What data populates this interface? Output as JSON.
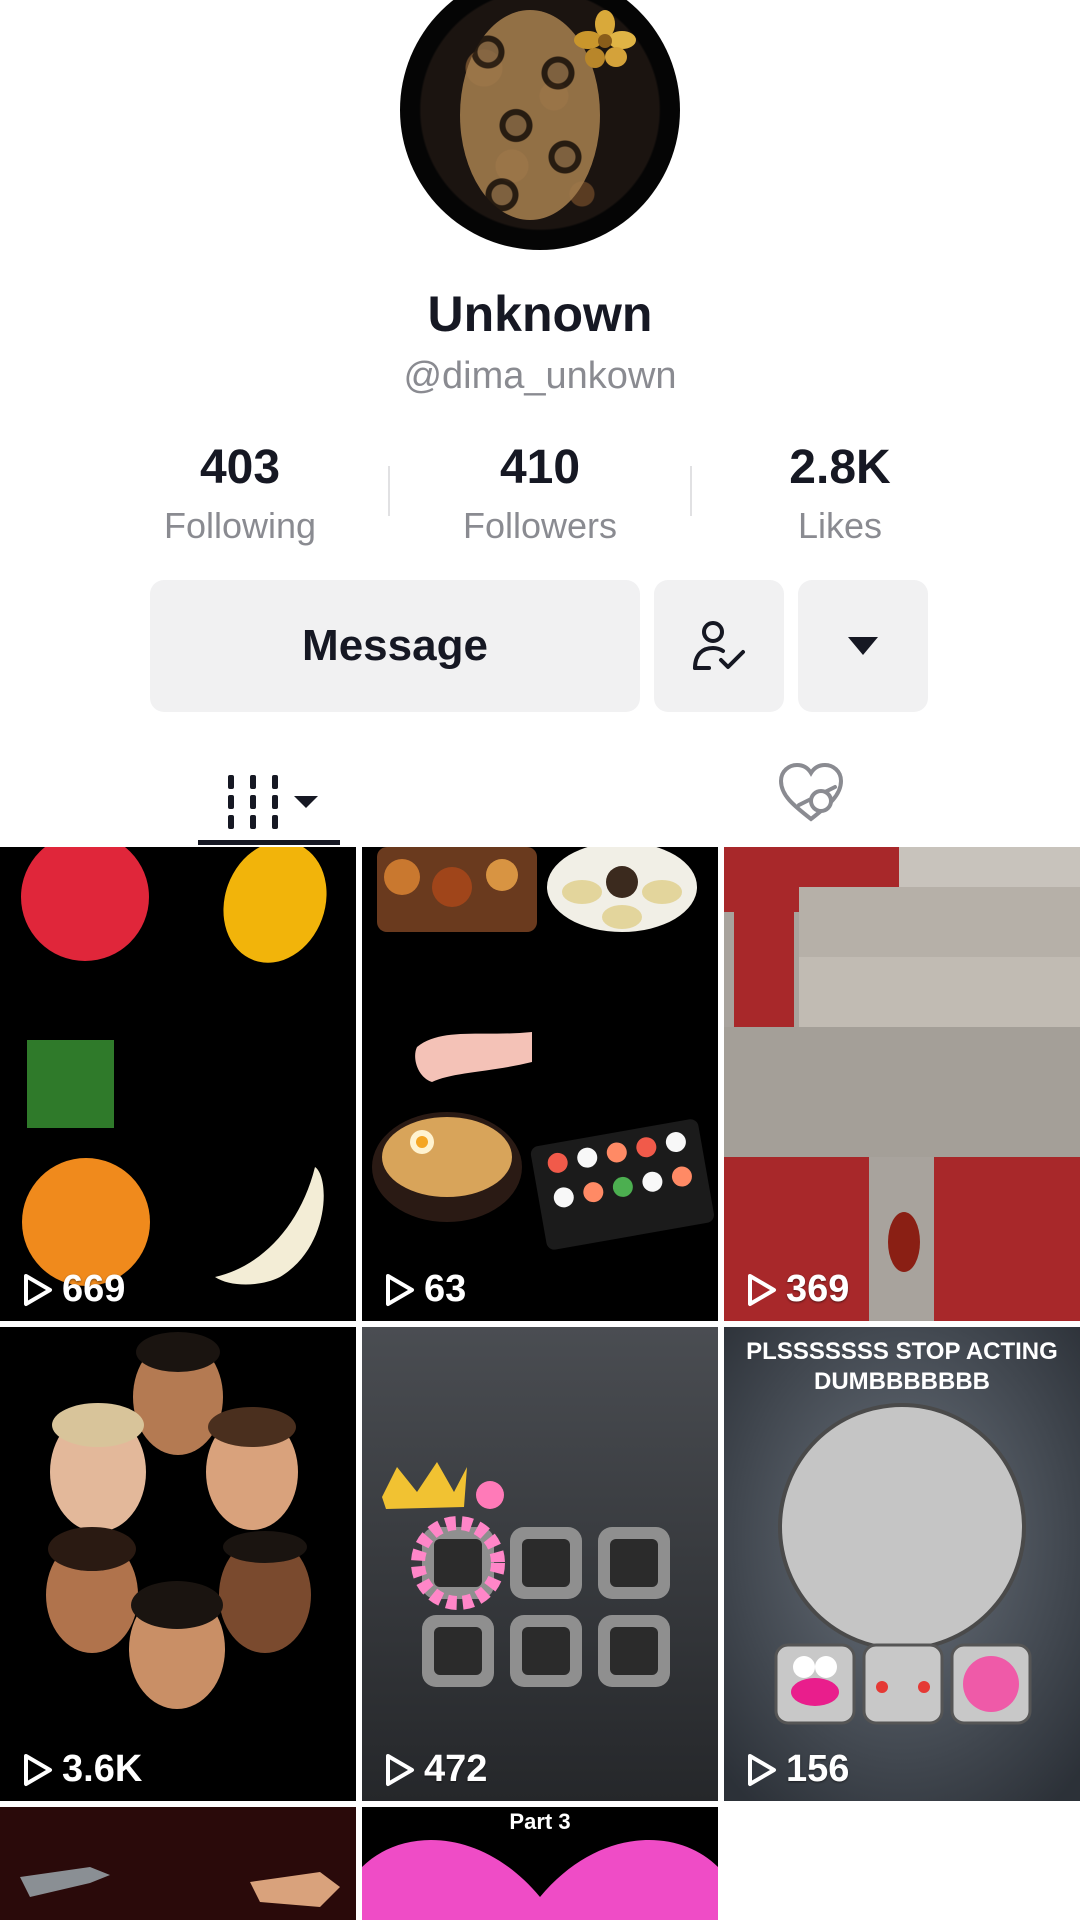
{
  "profile": {
    "name": "Unknown",
    "handle": "@dima_unkown"
  },
  "stats": [
    {
      "value": "403",
      "label": "Following"
    },
    {
      "value": "410",
      "label": "Followers"
    },
    {
      "value": "2.8K",
      "label": "Likes"
    }
  ],
  "actions": {
    "message_label": "Message",
    "friend_icon": "user-check-icon",
    "more_icon": "caret-down-icon"
  },
  "tabs": {
    "videos_icon": "grid-icon",
    "liked_icon": "hidden-heart-icon"
  },
  "videos": [
    {
      "views": "669"
    },
    {
      "views": "63"
    },
    {
      "views": "369"
    },
    {
      "views": "3.6K"
    },
    {
      "views": "472"
    },
    {
      "views": "156",
      "caption": "PLSSSSSSS STOP ACTING DUMBBBBBBB"
    },
    {},
    {
      "caption": "Part 3"
    }
  ],
  "colors": {
    "text": "#161823",
    "muted": "#8a8b91",
    "button_bg": "#f1f1f2"
  }
}
